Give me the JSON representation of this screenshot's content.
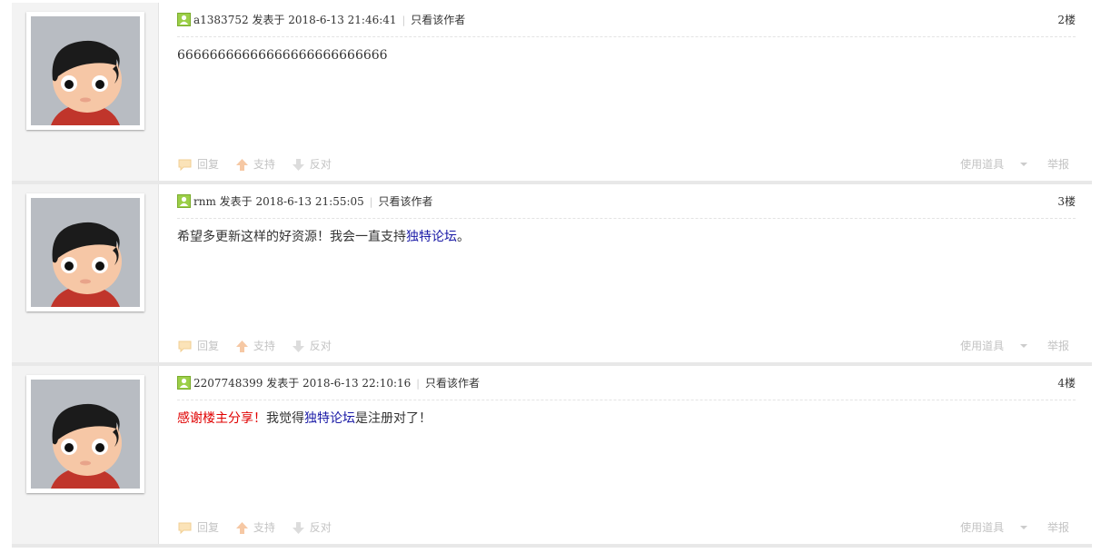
{
  "posts": [
    {
      "author": "a1383752",
      "posted_label": "发表于",
      "datetime": "2018-6-13 21:46:41",
      "only_author": "只看该作者",
      "floor": "2楼",
      "content": [
        {
          "text": "66666666666666666666666666",
          "style": "normal"
        }
      ]
    },
    {
      "author": "rnm",
      "posted_label": "发表于",
      "datetime": "2018-6-13 21:55:05",
      "only_author": "只看该作者",
      "floor": "3楼",
      "content": [
        {
          "text": "希望多更新这样的好资源！我会一直支持",
          "style": "normal"
        },
        {
          "text": "独特论坛",
          "style": "blue"
        },
        {
          "text": "。",
          "style": "normal"
        }
      ]
    },
    {
      "author": "2207748399",
      "posted_label": "发表于",
      "datetime": "2018-6-13 22:10:16",
      "only_author": "只看该作者",
      "floor": "4楼",
      "content": [
        {
          "text": "感谢楼主分享！",
          "style": "red"
        },
        {
          "text": "我觉得",
          "style": "normal"
        },
        {
          "text": "独特论坛",
          "style": "blue"
        },
        {
          "text": "是注册对了！",
          "style": "normal"
        }
      ]
    }
  ],
  "actions": {
    "reply": "回复",
    "support": "支持",
    "oppose": "反对",
    "tools": "使用道具",
    "report": "举报"
  },
  "icons": {
    "online": "user-online-icon",
    "reply": "reply-bubble-icon",
    "support": "arrow-up-icon",
    "oppose": "arrow-down-icon"
  },
  "colors": {
    "highlight_red": "#e00000",
    "link_blue": "#1a1aa6",
    "online_green": "#8cc63f",
    "muted_action": "#c3c3c3"
  }
}
